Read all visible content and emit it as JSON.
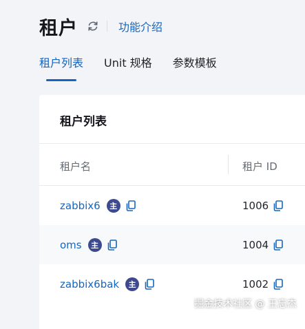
{
  "page": {
    "title": "租户",
    "intro_link": "功能介绍"
  },
  "tabs": [
    {
      "label": "租户列表",
      "active": true
    },
    {
      "label": "Unit 规格",
      "active": false
    },
    {
      "label": "参数模板",
      "active": false
    }
  ],
  "card": {
    "title": "租户列表"
  },
  "table": {
    "columns": [
      "租户名",
      "租户 ID"
    ],
    "rows": [
      {
        "name": "zabbix6",
        "badge": "主",
        "id": "1006"
      },
      {
        "name": "oms",
        "badge": "主",
        "id": "1004"
      },
      {
        "name": "zabbix6bak",
        "badge": "主",
        "id": "1002"
      }
    ]
  },
  "watermark": "掘金技术社区 @ 王忘杰",
  "colors": {
    "accent": "#1565c0",
    "badge": "#3d4a8f",
    "background": "#f2f4f7"
  },
  "icons": [
    "refresh-icon",
    "copy-icon"
  ]
}
